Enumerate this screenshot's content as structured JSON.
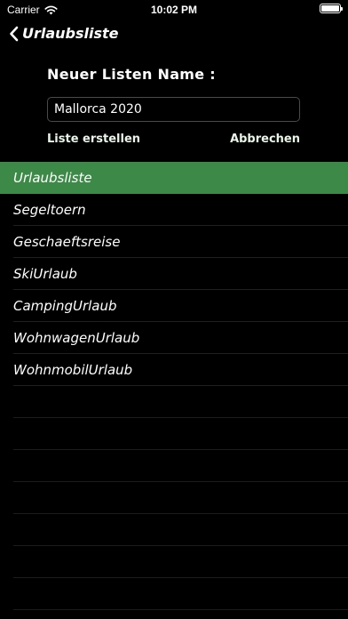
{
  "status_bar": {
    "carrier": "Carrier",
    "time": "10:02 PM",
    "battery_level": 1.0
  },
  "nav": {
    "back_label": "Urlaubsliste",
    "back_icon": "chevron-left-icon"
  },
  "new_list": {
    "title": "Neuer Listen Name :",
    "input_value": "Mallorca 2020",
    "create_label": "Liste erstellen",
    "cancel_label": "Abbrechen"
  },
  "lists": {
    "items": [
      {
        "label": "Urlaubsliste",
        "selected": true
      },
      {
        "label": "Segeltoern",
        "selected": false
      },
      {
        "label": "Geschaeftsreise",
        "selected": false
      },
      {
        "label": "SkiUrlaub",
        "selected": false
      },
      {
        "label": "CampingUrlaub",
        "selected": false
      },
      {
        "label": "WohnwagenUrlaub",
        "selected": false
      },
      {
        "label": "WohnmobilUrlaub",
        "selected": false
      }
    ]
  },
  "colors": {
    "background": "#000000",
    "selected_row": "#3d8a48",
    "separator": "#1f1f1f",
    "text": "#ffffff"
  }
}
